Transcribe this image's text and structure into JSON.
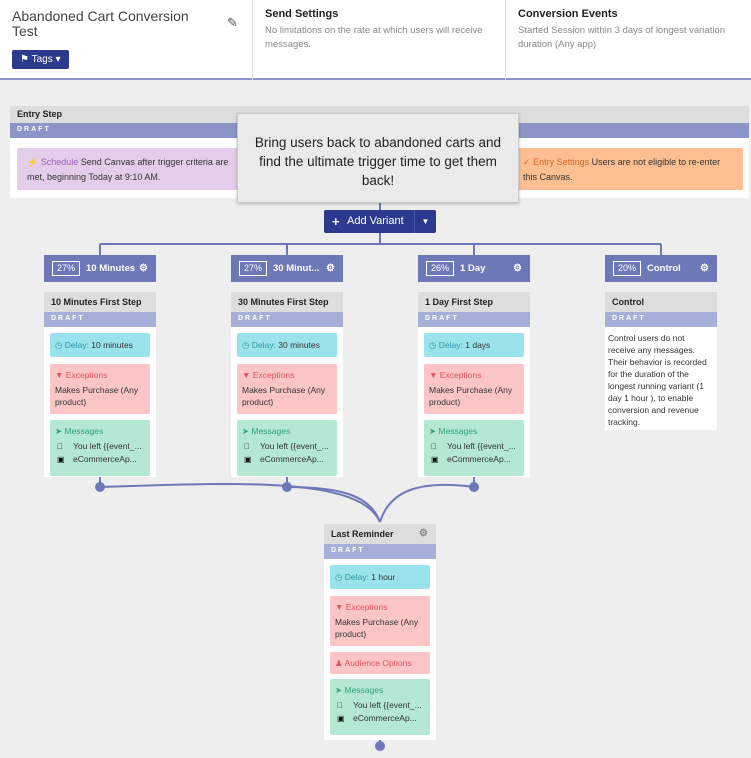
{
  "header": {
    "canvas_title": "Abandoned Cart Conversion Test",
    "tags_label": "Tags",
    "send_settings_title": "Send Settings",
    "send_settings_text": "No limitations on the rate at which users will receive messages.",
    "conversion_title": "Conversion Events",
    "conversion_text": "Started Session within 3 days of longest variation duration (Any app)"
  },
  "entry": {
    "title": "Entry Step",
    "draft": "DRAFT",
    "schedule_label": "Schedule",
    "schedule_text": "Send Canvas after trigger criteria are met, beginning Today at 9:10 AM.",
    "entry_settings_label": "Entry Settings",
    "entry_settings_text": "Users are not eligible to re-enter this Canvas."
  },
  "tooltip": "Bring users back to abandoned carts and find the ultimate trigger time to get them back!",
  "add_variant_label": "Add Variant",
  "variants": [
    {
      "pct": "27%",
      "name": "10 Minutes",
      "step_title": "10 Minutes First Step",
      "draft": "DRAFT",
      "delay_label": "Delay:",
      "delay_value": "10 minutes",
      "exceptions_label": "Exceptions",
      "exceptions_text": "Makes Purchase (Any product)",
      "messages_label": "Messages",
      "msg1": "You left {{event_...",
      "msg2": "eCommerceAp..."
    },
    {
      "pct": "27%",
      "name": "30 Minut...",
      "step_title": "30 Minutes First Step",
      "draft": "DRAFT",
      "delay_label": "Delay:",
      "delay_value": "30 minutes",
      "exceptions_label": "Exceptions",
      "exceptions_text": "Makes Purchase (Any product)",
      "messages_label": "Messages",
      "msg1": "You left {{event_...",
      "msg2": "eCommerceAp..."
    },
    {
      "pct": "26%",
      "name": "1 Day",
      "step_title": "1 Day First Step",
      "draft": "DRAFT",
      "delay_label": "Delay:",
      "delay_value": "1 days",
      "exceptions_label": "Exceptions",
      "exceptions_text": "Makes Purchase (Any product)",
      "messages_label": "Messages",
      "msg1": "You left {{event_...",
      "msg2": "eCommerceAp..."
    },
    {
      "pct": "20%",
      "name": "Control",
      "step_title": "Control",
      "draft": "DRAFT",
      "control_text": "Control users do not receive any messages. Their behavior is recorded for the duration of the longest running variant (1 day 1 hour ), to enable conversion and revenue tracking."
    }
  ],
  "last_reminder": {
    "title": "Last Reminder",
    "draft": "DRAFT",
    "delay_label": "Delay:",
    "delay_value": "1 hour",
    "exceptions_label": "Exceptions",
    "exceptions_text": "Makes Purchase (Any product)",
    "audience_label": "Audience Options",
    "messages_label": "Messages",
    "msg1": "You left {{event_...",
    "msg2": "eCommerceAp..."
  },
  "icons": {
    "pencil": "pencil-icon",
    "tag": "tag-icon",
    "gear": "gear-icon",
    "clock": "clock-icon",
    "filter": "filter-icon",
    "send": "paper-plane-icon",
    "apple": "apple-icon",
    "desktop": "desktop-icon",
    "people": "users-icon",
    "lightning": "lightning-icon"
  },
  "colors": {
    "primary": "#2b3a8c",
    "variant_header": "#6d78b8",
    "draft_bar": "#a7aed7",
    "delay": "#9be3ec",
    "exceptions": "#fbc5c5",
    "messages": "#b5e8d3",
    "schedule": "#e3cdea",
    "entry_settings": "#fdbf92"
  }
}
